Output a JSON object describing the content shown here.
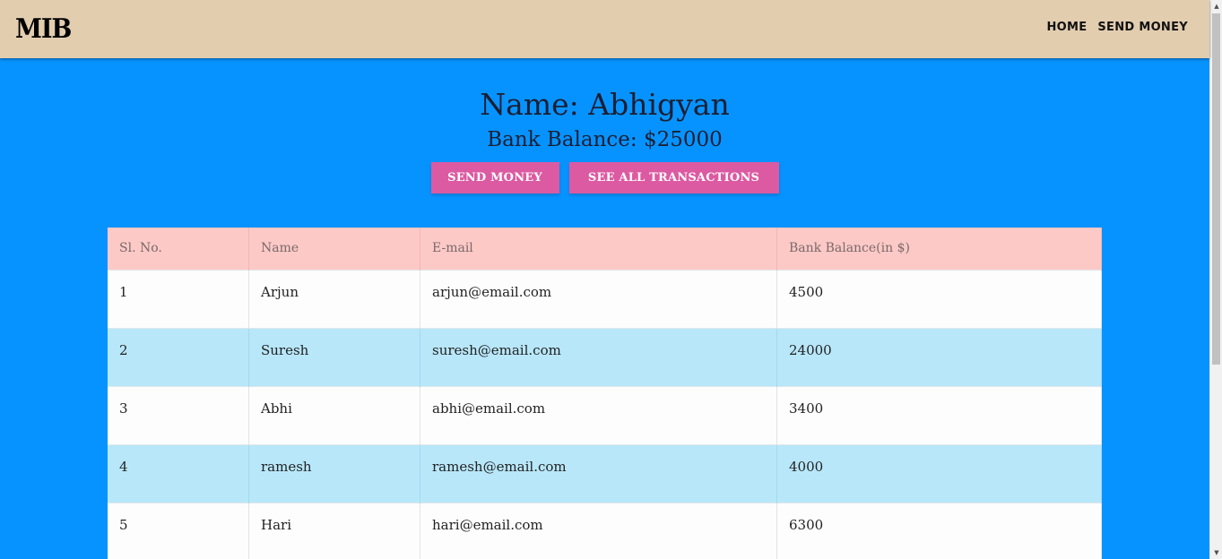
{
  "navbar": {
    "brand": "MIB",
    "links": [
      {
        "label": "HOME"
      },
      {
        "label": "SEND MONEY"
      }
    ]
  },
  "profile": {
    "name": "Name: Abhigyan",
    "balance": "Bank Balance: $25000"
  },
  "actions": {
    "send_money": "SEND MONEY",
    "see_transactions": "SEE ALL TRANSACTIONS"
  },
  "table": {
    "headers": [
      "Sl. No.",
      "Name",
      "E-mail",
      "Bank Balance(in $)"
    ],
    "rows": [
      [
        "1",
        "Arjun",
        "arjun@email.com",
        "4500"
      ],
      [
        "2",
        "Suresh",
        "suresh@email.com",
        "24000"
      ],
      [
        "3",
        "Abhi",
        "abhi@email.com",
        "3400"
      ],
      [
        "4",
        "ramesh",
        "ramesh@email.com",
        "4000"
      ],
      [
        "5",
        "Hari",
        "hari@email.com",
        "6300"
      ]
    ]
  },
  "colors": {
    "page_bg": "#0793ff",
    "navbar_bg": "#e2cdaf",
    "button_bg": "#dc5aa2",
    "table_header_bg": "#fcc9c6",
    "row_alt_bg": "#b8e7fa"
  }
}
